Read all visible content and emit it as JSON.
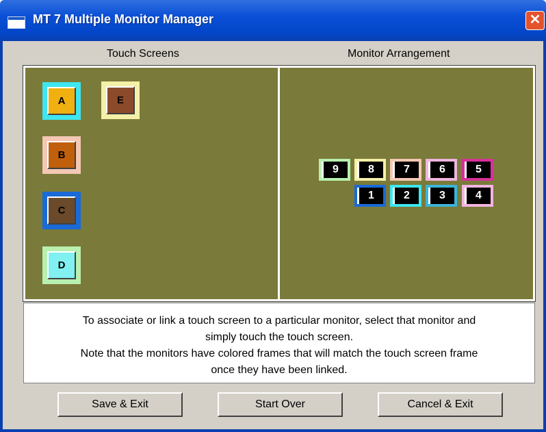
{
  "window": {
    "title": "MT 7 Multiple Monitor Manager",
    "close_glyph": "✕"
  },
  "touch_panel": {
    "heading": "Touch Screens",
    "buttons": [
      {
        "label": "A",
        "frame_color": "#3ee6f0",
        "fill_color": "#f0b010"
      },
      {
        "label": "E",
        "frame_color": "#f5f0a8",
        "fill_color": "#8b4a2a"
      },
      {
        "label": "B",
        "frame_color": "#f4c8b4",
        "fill_color": "#c0600c"
      },
      {
        "label": "C",
        "frame_color": "#1a6ad8",
        "fill_color": "#6a4a2a"
      },
      {
        "label": "D",
        "frame_color": "#b8f0b0",
        "fill_color": "#80f0f0"
      }
    ]
  },
  "monitor_panel": {
    "heading": "Monitor Arrangement",
    "monitors": [
      {
        "label": "9",
        "frame_color": "#b8f0b0"
      },
      {
        "label": "8",
        "frame_color": "#f5f0a8"
      },
      {
        "label": "7",
        "frame_color": "#f4c8b4"
      },
      {
        "label": "6",
        "frame_color": "#f0b4e0"
      },
      {
        "label": "5",
        "frame_color": "#d8309a"
      },
      {
        "label": "1",
        "frame_color": "#1a6ad8"
      },
      {
        "label": "2",
        "frame_color": "#3ee6f0"
      },
      {
        "label": "3",
        "frame_color": "#3cb4d8"
      },
      {
        "label": "4",
        "frame_color": "#f0b4e0"
      }
    ]
  },
  "instructions": {
    "line1": "To associate or link a touch screen to a particular monitor, select that monitor and",
    "line2": "simply touch the touch screen.",
    "line3": "Note that the monitors have colored frames that will match the touch screen frame",
    "line4": "once they have been linked."
  },
  "buttons": {
    "save_exit": "Save & Exit",
    "start_over": "Start Over",
    "cancel_exit": "Cancel & Exit"
  },
  "colors": {
    "panel_bg": "#7a7a3a",
    "dialog_bg": "#d4d0c8",
    "titlebar": "#0a4fd6"
  }
}
